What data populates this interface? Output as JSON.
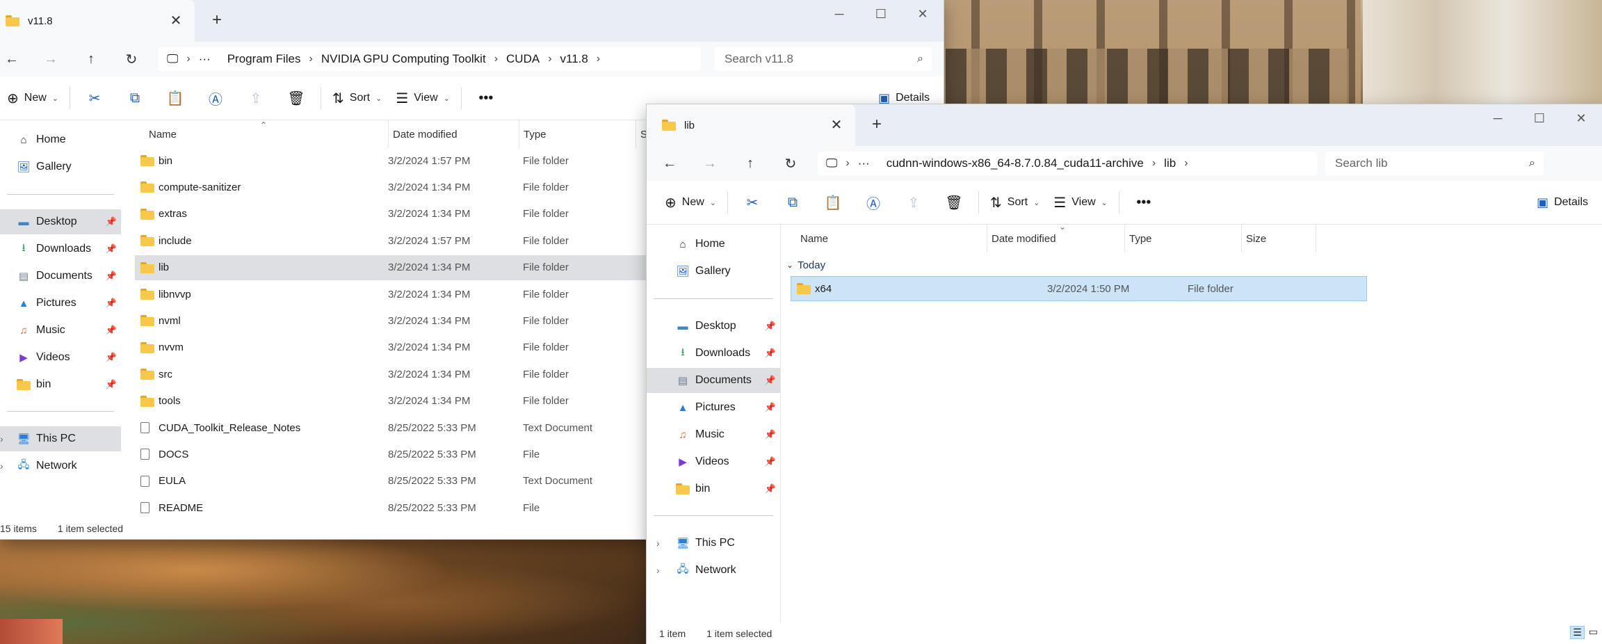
{
  "window1": {
    "tab_title": "v11.8",
    "breadcrumb": [
      "Program Files",
      "NVIDIA GPU Computing Toolkit",
      "CUDA",
      "v11.8"
    ],
    "search_placeholder": "Search v11.8",
    "toolbar": {
      "new": "New",
      "sort": "Sort",
      "view": "View",
      "details": "Details"
    },
    "nav": [
      "Home",
      "Gallery",
      "Desktop",
      "Downloads",
      "Documents",
      "Pictures",
      "Music",
      "Videos",
      "bin",
      "This PC",
      "Network"
    ],
    "columns": {
      "name": "Name",
      "date": "Date modified",
      "type": "Type",
      "size": "S"
    },
    "files": [
      {
        "name": "bin",
        "date": "3/2/2024 1:57 PM",
        "type": "File folder",
        "kind": "folder"
      },
      {
        "name": "compute-sanitizer",
        "date": "3/2/2024 1:34 PM",
        "type": "File folder",
        "kind": "folder"
      },
      {
        "name": "extras",
        "date": "3/2/2024 1:34 PM",
        "type": "File folder",
        "kind": "folder"
      },
      {
        "name": "include",
        "date": "3/2/2024 1:57 PM",
        "type": "File folder",
        "kind": "folder"
      },
      {
        "name": "lib",
        "date": "3/2/2024 1:34 PM",
        "type": "File folder",
        "kind": "folder"
      },
      {
        "name": "libnvvp",
        "date": "3/2/2024 1:34 PM",
        "type": "File folder",
        "kind": "folder"
      },
      {
        "name": "nvml",
        "date": "3/2/2024 1:34 PM",
        "type": "File folder",
        "kind": "folder"
      },
      {
        "name": "nvvm",
        "date": "3/2/2024 1:34 PM",
        "type": "File folder",
        "kind": "folder"
      },
      {
        "name": "src",
        "date": "3/2/2024 1:34 PM",
        "type": "File folder",
        "kind": "folder"
      },
      {
        "name": "tools",
        "date": "3/2/2024 1:34 PM",
        "type": "File folder",
        "kind": "folder"
      },
      {
        "name": "CUDA_Toolkit_Release_Notes",
        "date": "8/25/2022 5:33 PM",
        "type": "Text Document",
        "kind": "doc"
      },
      {
        "name": "DOCS",
        "date": "8/25/2022 5:33 PM",
        "type": "File",
        "kind": "doc"
      },
      {
        "name": "EULA",
        "date": "8/25/2022 5:33 PM",
        "type": "Text Document",
        "kind": "doc"
      },
      {
        "name": "README",
        "date": "8/25/2022 5:33 PM",
        "type": "File",
        "kind": "doc"
      }
    ],
    "selected_file": "lib",
    "status": {
      "count": "15 items",
      "selected": "1 item selected"
    }
  },
  "window2": {
    "tab_title": "lib",
    "breadcrumb": [
      "cudnn-windows-x86_64-8.7.0.84_cuda11-archive",
      "lib"
    ],
    "search_placeholder": "Search lib",
    "toolbar": {
      "new": "New",
      "sort": "Sort",
      "view": "View",
      "details": "Details"
    },
    "nav": [
      "Home",
      "Gallery",
      "Desktop",
      "Downloads",
      "Documents",
      "Pictures",
      "Music",
      "Videos",
      "bin",
      "This PC",
      "Network"
    ],
    "columns": {
      "name": "Name",
      "date": "Date modified",
      "type": "Type",
      "size": "Size"
    },
    "group": "Today",
    "files": [
      {
        "name": "x64",
        "date": "3/2/2024 1:50 PM",
        "type": "File folder",
        "kind": "folder"
      }
    ],
    "selected_nav": "Documents",
    "status": {
      "count": "1 item",
      "selected": "1 item selected"
    }
  },
  "icons": [
    "folder-icon",
    "home-icon",
    "gallery-icon",
    "desktop-icon",
    "downloads-icon",
    "documents-icon",
    "pictures-icon",
    "music-icon",
    "videos-icon",
    "pc-icon",
    "network-icon",
    "pin-icon",
    "cut-icon",
    "copy-icon",
    "paste-icon",
    "rename-icon",
    "share-icon",
    "delete-icon",
    "search-icon"
  ],
  "colors": {
    "accent": "#1f5fb8",
    "selection": "#dddfe2",
    "selection_blue": "#cce4f7",
    "folder": "#f8c84a"
  }
}
